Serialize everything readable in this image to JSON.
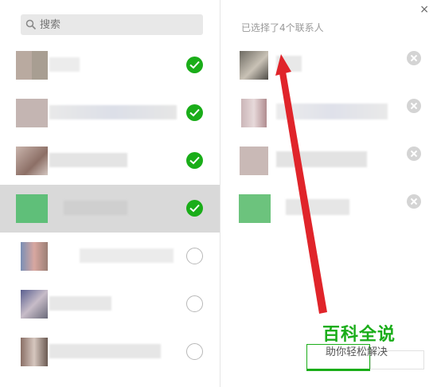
{
  "search": {
    "placeholder": "搜索",
    "icon": "search-icon"
  },
  "right_panel": {
    "selected_count_text": "已选择了4个联系人"
  },
  "close_label": "×",
  "contacts": [
    {
      "selected": true,
      "row_highlighted": false
    },
    {
      "selected": true,
      "row_highlighted": false
    },
    {
      "selected": true,
      "row_highlighted": false
    },
    {
      "selected": true,
      "row_highlighted": true
    },
    {
      "selected": false,
      "row_highlighted": false
    },
    {
      "selected": false,
      "row_highlighted": false
    },
    {
      "selected": false,
      "row_highlighted": false
    }
  ],
  "selected_contacts": 4,
  "watermark": {
    "title": "百科全说",
    "subtitle": "助你轻松解决"
  },
  "colors": {
    "accent": "#1aad19",
    "annotation": "#e0242a"
  }
}
